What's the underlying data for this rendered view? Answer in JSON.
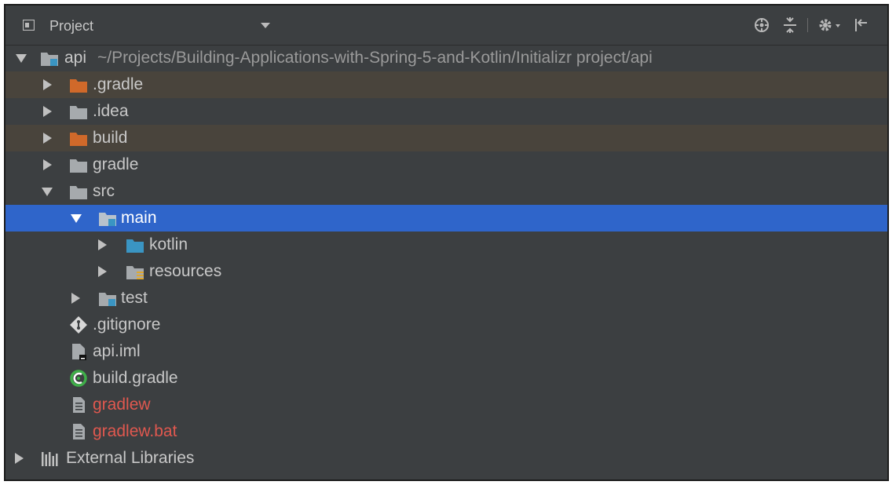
{
  "panel": {
    "title": "Project"
  },
  "toolbar": {
    "icons": [
      "locate-icon",
      "collapse-all-icon",
      "settings-icon",
      "hide-panel-icon"
    ]
  },
  "tree": {
    "root": {
      "name": "api",
      "path": "~/Projects/Building-Applications-with-Spring-5-and-Kotlin/Initializr project/api"
    },
    "items": [
      {
        "label": ".gradle"
      },
      {
        "label": ".idea"
      },
      {
        "label": "build"
      },
      {
        "label": "gradle"
      },
      {
        "label": "src"
      },
      {
        "label": "main"
      },
      {
        "label": "kotlin"
      },
      {
        "label": "resources"
      },
      {
        "label": "test"
      },
      {
        "label": ".gitignore"
      },
      {
        "label": "api.iml"
      },
      {
        "label": "build.gradle"
      },
      {
        "label": "gradlew"
      },
      {
        "label": "gradlew.bat"
      }
    ],
    "external": {
      "label": "External Libraries"
    }
  },
  "colors": {
    "panel_bg": "#3c3f41",
    "selection": "#2f65ca",
    "excluded_tint": "#49443c",
    "excluded_folder": "#d0692a",
    "source_folder": "#3a95c3",
    "untracked_text": "#e0584f"
  }
}
